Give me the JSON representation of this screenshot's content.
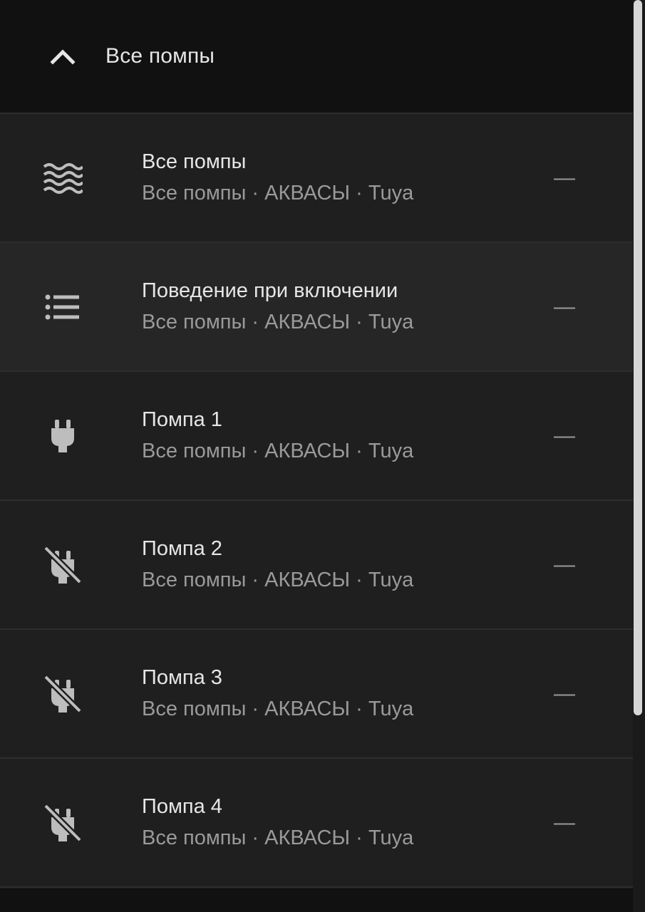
{
  "header": {
    "title": "Все помпы",
    "collapse_icon": "chevron-up-icon"
  },
  "rows": [
    {
      "icon": "waves-icon",
      "name": "Все помпы",
      "sub": "Все помпы · АКВАСЫ · Tuya",
      "state": "—"
    },
    {
      "icon": "list-icon",
      "name": "Поведение при включении",
      "sub": "Все помпы · АКВАСЫ · Tuya",
      "state": "—"
    },
    {
      "icon": "power-plug-icon",
      "name": "Помпа 1",
      "sub": "Все помпы · АКВАСЫ · Tuya",
      "state": "—"
    },
    {
      "icon": "power-plug-off-icon",
      "name": "Помпа 2",
      "sub": "Все помпы · АКВАСЫ · Tuya",
      "state": "—"
    },
    {
      "icon": "power-plug-off-icon",
      "name": "Помпа 3",
      "sub": "Все помпы · АКВАСЫ · Tuya",
      "state": "—"
    },
    {
      "icon": "power-plug-off-icon",
      "name": "Помпа 4",
      "sub": "Все помпы · АКВАСЫ · Tuya",
      "state": "—"
    }
  ],
  "colors": {
    "background": "#1f1f1f",
    "header": "#111111",
    "text_primary": "#e6e6e6",
    "text_secondary": "#9a9a9a",
    "icon": "#bdbdbd",
    "scrollbar": "#d6d6d6"
  }
}
